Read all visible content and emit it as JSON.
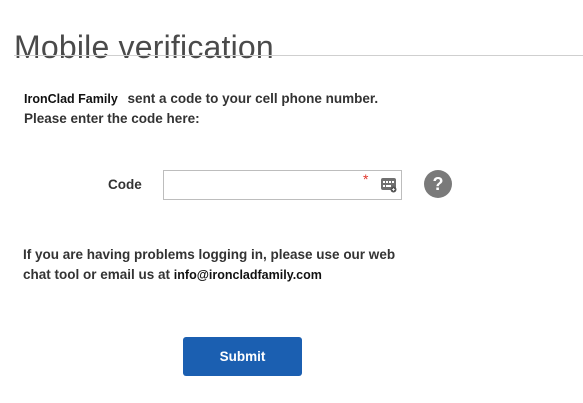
{
  "page": {
    "title": "Mobile verification"
  },
  "intro": {
    "brand": "IronClad Family",
    "line1_rest": "sent a code to your cell phone number.",
    "line2": "Please enter the code here:"
  },
  "code_field": {
    "label": "Code",
    "value": "",
    "placeholder": "",
    "required_marker": "*",
    "keypad_icon": "keypad-icon"
  },
  "help": {
    "icon_glyph": "?",
    "icon": "help-icon",
    "line1": "If you are having problems logging in, please use our web",
    "line2_prefix": "chat tool or email us at",
    "email": "info@ironcladfamily.com"
  },
  "actions": {
    "submit_label": "Submit"
  },
  "colors": {
    "submit_bg": "#1b5fb1",
    "required_star": "#e0352b",
    "help_icon_bg": "#7a7a7a",
    "divider": "#cfcfcf"
  }
}
